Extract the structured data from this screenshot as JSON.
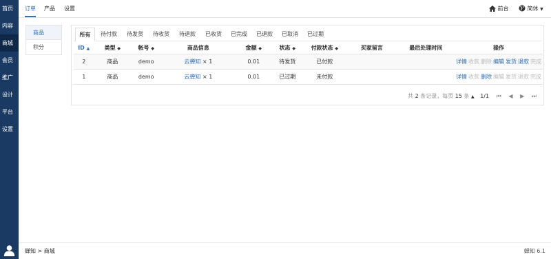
{
  "leftnav": {
    "items": [
      "首页",
      "内容",
      "商城",
      "会员",
      "推广",
      "设计",
      "平台",
      "设置"
    ]
  },
  "topbar": {
    "tabs": [
      "订单",
      "产品",
      "设置"
    ],
    "frontend": "前台",
    "language": "简体"
  },
  "subnav": {
    "items": [
      "商品",
      "积分"
    ]
  },
  "status_tabs": [
    "所有",
    "待付款",
    "待发货",
    "待收货",
    "待退款",
    "已收货",
    "已完成",
    "已退款",
    "已取消",
    "已过期"
  ],
  "table": {
    "headers": [
      "ID",
      "类型",
      "帐号",
      "商品信息",
      "金额",
      "状态",
      "付款状态",
      "买家留言",
      "最后处理时间",
      "操作"
    ],
    "rows": [
      {
        "id": "2",
        "type": "商品",
        "account": "demo",
        "product_name": "云蝉知",
        "product_qty": "× 1",
        "amount": "0.01",
        "status": "待发货",
        "pay_status": "已付款",
        "message": "",
        "last_time": "",
        "ops": [
          "详情",
          "收款",
          "删除",
          "编辑",
          "发货",
          "退款",
          "完成"
        ]
      },
      {
        "id": "1",
        "type": "商品",
        "account": "demo",
        "product_name": "云蝉知",
        "product_qty": "× 1",
        "amount": "0.01",
        "status": "已过期",
        "pay_status": "未付款",
        "message": "",
        "last_time": "",
        "ops": [
          "详情",
          "收款",
          "删除",
          "编辑",
          "发货",
          "退款",
          "完成"
        ]
      }
    ]
  },
  "pager": {
    "total_prefix": "共",
    "total": "2",
    "total_suffix": "条记录，每页",
    "per_page": "15",
    "per_page_suffix": "条",
    "page": "1/1"
  },
  "footer": {
    "crumb_root": "蝉知",
    "crumb_sep": ">",
    "crumb_current": "商城",
    "version": "蝉知 6.1"
  },
  "colors": {
    "nav_bg": "#1b3a63",
    "accent": "#2f6db3",
    "disabled": "#bbbbbb"
  }
}
